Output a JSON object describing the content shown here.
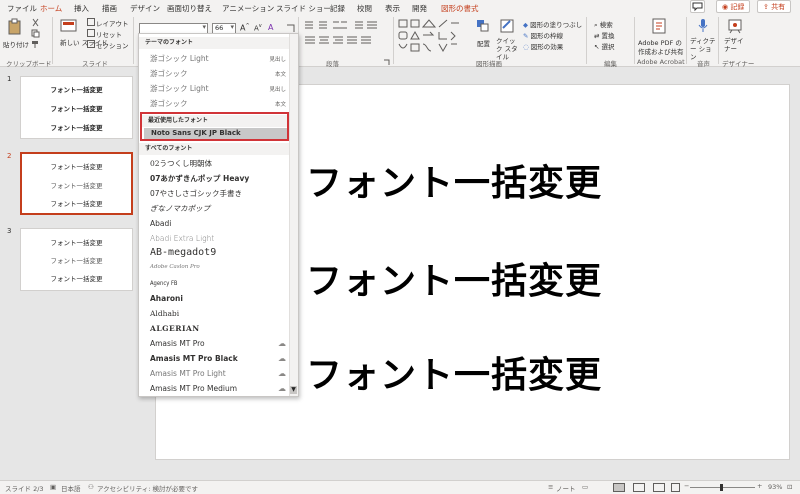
{
  "tabs": [
    {
      "label": "ファイル",
      "active": false
    },
    {
      "label": "ホーム",
      "active": true
    },
    {
      "label": "挿入",
      "active": false
    },
    {
      "label": "描画",
      "active": false
    },
    {
      "label": "デザイン",
      "active": false
    },
    {
      "label": "画面切り替え",
      "active": false
    },
    {
      "label": "アニメーション",
      "active": false
    },
    {
      "label": "スライド ショー",
      "active": false
    },
    {
      "label": "記録",
      "active": false
    },
    {
      "label": "校閲",
      "active": false
    },
    {
      "label": "表示",
      "active": false
    },
    {
      "label": "開発",
      "active": false
    },
    {
      "label": "図形の書式",
      "active": false,
      "contextual": true
    }
  ],
  "titlebar": {
    "record_label": "記録",
    "share_label": "共有"
  },
  "ribbon": {
    "clipboard": {
      "paste": "貼り付け",
      "group": "クリップボード"
    },
    "slides": {
      "new_slide": "新しい スライド",
      "layout": "レイアウト",
      "reset": "リセット",
      "section": "セクション",
      "group": "スライド"
    },
    "font": {
      "size_value": "66",
      "group": ""
    },
    "paragraph": {
      "group": "段落"
    },
    "drawing": {
      "arrange": "配置",
      "quick_style": "クイック スタイル",
      "fill": "図形の塗りつぶし",
      "outline": "図形の枠線",
      "effects": "図形の効果",
      "group": "図形描画"
    },
    "editing": {
      "find": "検索",
      "replace": "置換",
      "select": "選択",
      "group": "編集"
    },
    "acrobat": {
      "create_pdf_line1": "Adobe PDF の",
      "create_pdf_line2": "作成および共有",
      "group": "Adobe Acrobat"
    },
    "voice": {
      "dictate": "ディクテー ション",
      "group": "音声"
    },
    "designer": {
      "designer": "デザイ ナー",
      "group": "デザイナー"
    }
  },
  "font_dropdown": {
    "theme_header": "テーマのフォント",
    "theme_fonts": [
      {
        "name": "游ゴシック Light",
        "tag": "見出し"
      },
      {
        "name": "游ゴシック",
        "tag": "本文"
      },
      {
        "name": "游ゴシック Light",
        "tag": "見出し"
      },
      {
        "name": "游ゴシック",
        "tag": "本文"
      }
    ],
    "recent_header": "最近使用したフォント",
    "recent_font": "Noto Sans CJK JP Black",
    "all_header": "すべてのフォント",
    "all_fonts": [
      {
        "name": "02うつくし明朝体",
        "cloud": false
      },
      {
        "name": "07あかずきんポップ Heavy",
        "cloud": false
      },
      {
        "name": "07やさしさゴシック手書き",
        "cloud": false
      },
      {
        "name": "ぎなノマカポップ",
        "cloud": false
      },
      {
        "name": "Abadi",
        "cloud": false
      },
      {
        "name": "Abadi Extra Light",
        "cloud": false
      },
      {
        "name": "AB-megadot9",
        "cloud": false
      },
      {
        "name": "Adobe Caslon Pro",
        "cloud": false
      },
      {
        "name": "Agency FB",
        "cloud": false
      },
      {
        "name": "Aharoni",
        "cloud": false
      },
      {
        "name": "Aldhabi",
        "cloud": false
      },
      {
        "name": "ALGERIAN",
        "cloud": false
      },
      {
        "name": "Amasis MT Pro",
        "cloud": true
      },
      {
        "name": "Amasis MT Pro Black",
        "cloud": true
      },
      {
        "name": "Amasis MT Pro Light",
        "cloud": true
      },
      {
        "name": "Amasis MT Pro Medium",
        "cloud": true
      }
    ]
  },
  "slides_panel": [
    {
      "num": "1",
      "lines": [
        "フォント一括変更",
        "フォント一括変更",
        "フォント一括変更"
      ],
      "selected": false
    },
    {
      "num": "2",
      "lines": [
        "フォント一括変更",
        "フォント一括変更",
        "フォント一括変更"
      ],
      "selected": true
    },
    {
      "num": "3",
      "lines": [
        "フォント一括変更",
        "フォント一括変更",
        "フォント一括変更"
      ],
      "selected": false
    }
  ],
  "slide": {
    "lines": [
      "フォント一括変更",
      "フォント一括変更",
      "フォント一括変更"
    ]
  },
  "statusbar": {
    "slide_pos": "スライド 2/3",
    "language": "日本語",
    "accessibility": "アクセシビリティ: 検討が必要です",
    "notes": "ノート",
    "zoom": "93%"
  }
}
